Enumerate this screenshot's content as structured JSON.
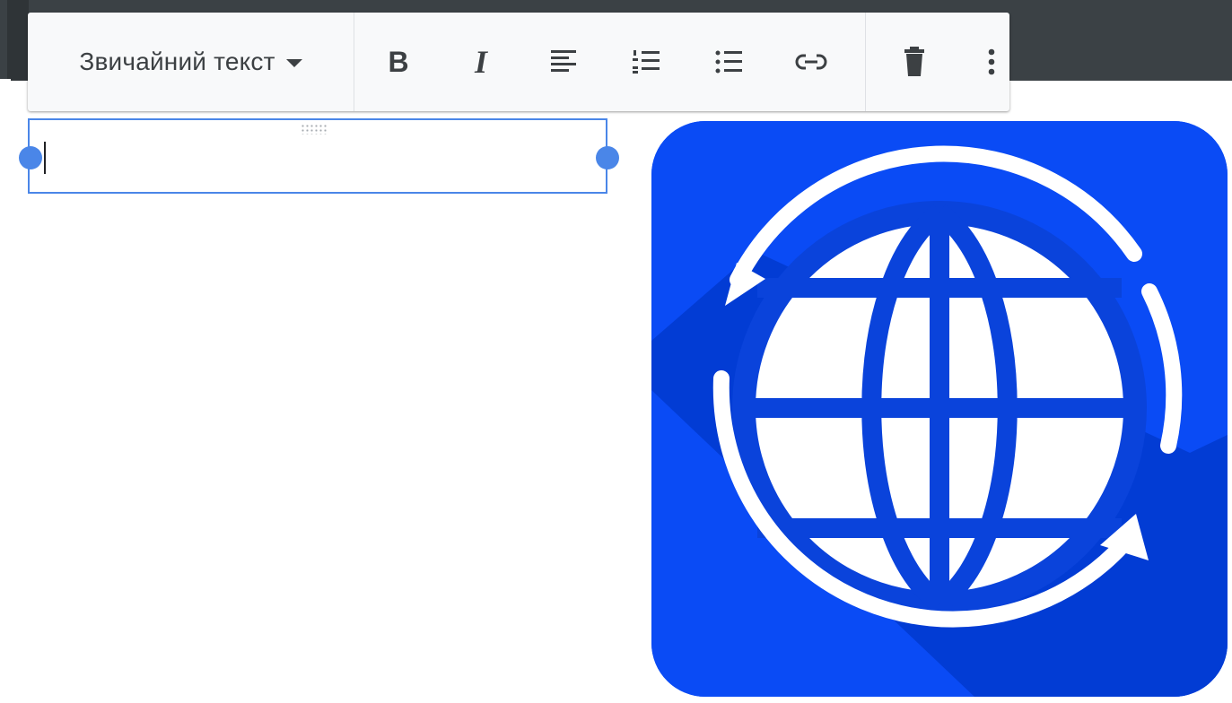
{
  "toolbar": {
    "style_label": "Звичайний текст",
    "bold_label": "B",
    "italic_label": "I"
  },
  "icons": {
    "style_dropdown": "chevron-down-icon",
    "bold": "bold-icon",
    "italic": "italic-icon",
    "align": "align-left-icon",
    "numbered_list": "numbered-list-icon",
    "bulleted_list": "bulleted-list-icon",
    "link": "link-icon",
    "delete": "trash-icon",
    "more": "more-vertical-icon",
    "image": "globe-sync-icon"
  },
  "colors": {
    "accent": "#4a86e8",
    "toolbar_background": "#f8f9fa",
    "header_band": "#3b4145",
    "globe_background": "#0a4bf5",
    "globe_shadow": "#0037c8"
  },
  "text_box": {
    "value": ""
  }
}
